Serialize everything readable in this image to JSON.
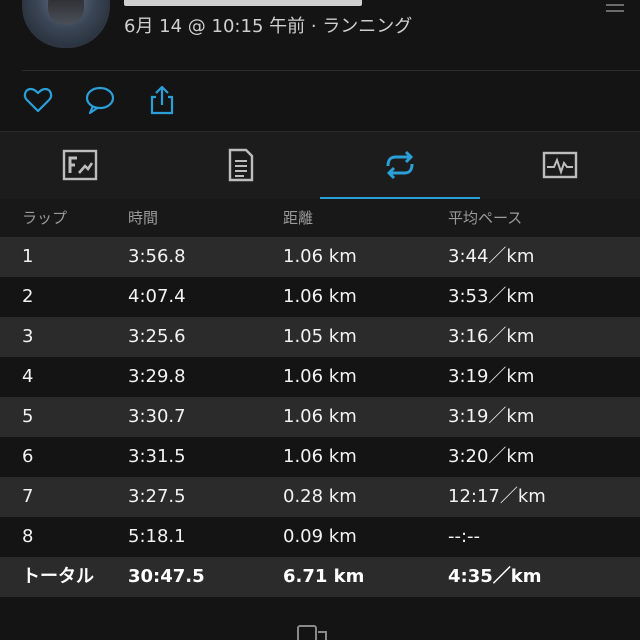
{
  "activity": {
    "subtitle": "6月 14 @ 10:15 午前 · ランニング"
  },
  "actions": [
    "heart-icon",
    "comment-icon",
    "share-icon"
  ],
  "tabs": [
    {
      "icon": "overview-icon",
      "active": false
    },
    {
      "icon": "stats-icon",
      "active": false
    },
    {
      "icon": "laps-icon",
      "active": true
    },
    {
      "icon": "charts-icon",
      "active": false
    }
  ],
  "colors": {
    "accent": "#2a9fd8",
    "background": "#141414",
    "row_alt": "#2b2b2b"
  },
  "laps": {
    "headers": {
      "lap": "ラップ",
      "time": "時間",
      "distance": "距離",
      "pace": "平均ペース"
    },
    "rows": [
      {
        "lap": "1",
        "time": "3:56.8",
        "distance": "1.06 km",
        "pace": "3:44／km"
      },
      {
        "lap": "2",
        "time": "4:07.4",
        "distance": "1.06 km",
        "pace": "3:53／km"
      },
      {
        "lap": "3",
        "time": "3:25.6",
        "distance": "1.05 km",
        "pace": "3:16／km"
      },
      {
        "lap": "4",
        "time": "3:29.8",
        "distance": "1.06 km",
        "pace": "3:19／km"
      },
      {
        "lap": "5",
        "time": "3:30.7",
        "distance": "1.06 km",
        "pace": "3:19／km"
      },
      {
        "lap": "6",
        "time": "3:31.5",
        "distance": "1.06 km",
        "pace": "3:20／km"
      },
      {
        "lap": "7",
        "time": "3:27.5",
        "distance": "0.28 km",
        "pace": "12:17／km"
      },
      {
        "lap": "8",
        "time": "5:18.1",
        "distance": "0.09 km",
        "pace": "--:--"
      }
    ],
    "total": {
      "label": "トータル",
      "time": "30:47.5",
      "distance": "6.71 km",
      "pace": "4:35／km"
    }
  }
}
